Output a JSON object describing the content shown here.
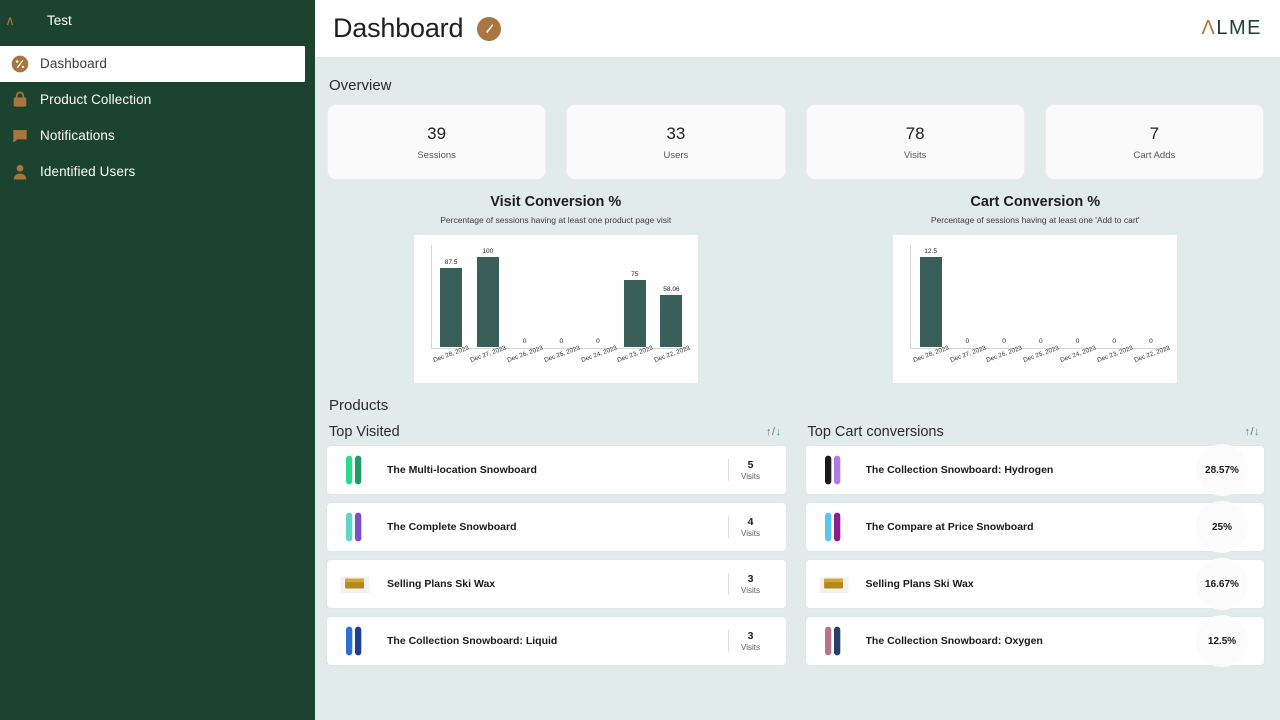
{
  "sidebar": {
    "brand_mark": "∧",
    "brand_text": "Test",
    "items": [
      {
        "label": "Dashboard",
        "icon": "gauge-icon",
        "active": true
      },
      {
        "label": "Product Collection",
        "icon": "bag-icon",
        "active": false
      },
      {
        "label": "Notifications",
        "icon": "chat-bubble-icon",
        "active": false
      },
      {
        "label": "Identified Users",
        "icon": "user-icon",
        "active": false
      }
    ]
  },
  "topbar": {
    "title": "Dashboard",
    "badge_icon": "gauge-icon",
    "logo_a": "Λ",
    "logo_rest": "LME"
  },
  "overview": {
    "heading": "Overview",
    "cards": [
      {
        "value": "39",
        "label": "Sessions"
      },
      {
        "value": "33",
        "label": "Users"
      },
      {
        "value": "78",
        "label": "Visits"
      },
      {
        "value": "7",
        "label": "Cart Adds"
      }
    ]
  },
  "chart_data": [
    {
      "type": "bar",
      "title": "Visit Conversion %",
      "subtitle": "Percentage of sessions having at least one product page visit",
      "categories": [
        "Dec 28, 2023",
        "Dec 27, 2023",
        "Dec 26, 2023",
        "Dec 25, 2023",
        "Dec 24, 2023",
        "Dec 23, 2023",
        "Dec 22, 2023"
      ],
      "values": [
        87.5,
        100,
        0,
        0,
        0,
        75,
        58.06
      ],
      "labels": [
        "87.5",
        "100",
        "0",
        "0",
        "0",
        "75",
        "58.06"
      ],
      "xlabel": "",
      "ylabel": "",
      "ylim": [
        0,
        100
      ],
      "grid": false,
      "legend": false,
      "bar_color": "#3A5F5A"
    },
    {
      "type": "bar",
      "title": "Cart Conversion %",
      "subtitle": "Percentage of sessions having at least one 'Add to cart'",
      "categories": [
        "Dec 28, 2023",
        "Dec 27, 2023",
        "Dec 26, 2023",
        "Dec 25, 2023",
        "Dec 24, 2023",
        "Dec 23, 2023",
        "Dec 22, 2023"
      ],
      "values": [
        12.5,
        0,
        0,
        0,
        0,
        0,
        0
      ],
      "labels": [
        "12.5",
        "0",
        "0",
        "0",
        "0",
        "0",
        "0"
      ],
      "xlabel": "",
      "ylabel": "",
      "ylim": [
        0,
        12.5
      ],
      "grid": false,
      "legend": false,
      "bar_color": "#3A5F5A"
    }
  ],
  "products": {
    "heading": "Products",
    "sort_up": "↑",
    "sort_sep": "/",
    "sort_down": "↓",
    "top_visited": {
      "title": "Top Visited",
      "metric_label": "Visits",
      "rows": [
        {
          "name": "The Multi-location Snowboard",
          "value": "5",
          "thumb": "snowboard-green"
        },
        {
          "name": "The Complete Snowboard",
          "value": "4",
          "thumb": "snowboard-teal"
        },
        {
          "name": "Selling Plans Ski Wax",
          "value": "3",
          "thumb": "ski-wax-gold"
        },
        {
          "name": "The Collection Snowboard: Liquid",
          "value": "3",
          "thumb": "snowboard-blue"
        }
      ]
    },
    "top_cart": {
      "title": "Top Cart conversions",
      "rows": [
        {
          "name": "The Collection Snowboard: Hydrogen",
          "value": "28.57%",
          "thumb": "snowboard-purple"
        },
        {
          "name": "The Compare at Price Snowboard",
          "value": "25%",
          "thumb": "snowboard-cyan"
        },
        {
          "name": "Selling Plans Ski Wax",
          "value": "16.67%",
          "thumb": "ski-wax-gold"
        },
        {
          "name": "The Collection Snowboard: Oxygen",
          "value": "12.5%",
          "thumb": "snowboard-maroon"
        }
      ]
    }
  },
  "colors": {
    "sidebar": "#1C432F",
    "accent_gold": "#A8763E",
    "content_bg": "#E1ECEA",
    "bar": "#3A5F5A",
    "sort_active": "#3FA06B"
  }
}
